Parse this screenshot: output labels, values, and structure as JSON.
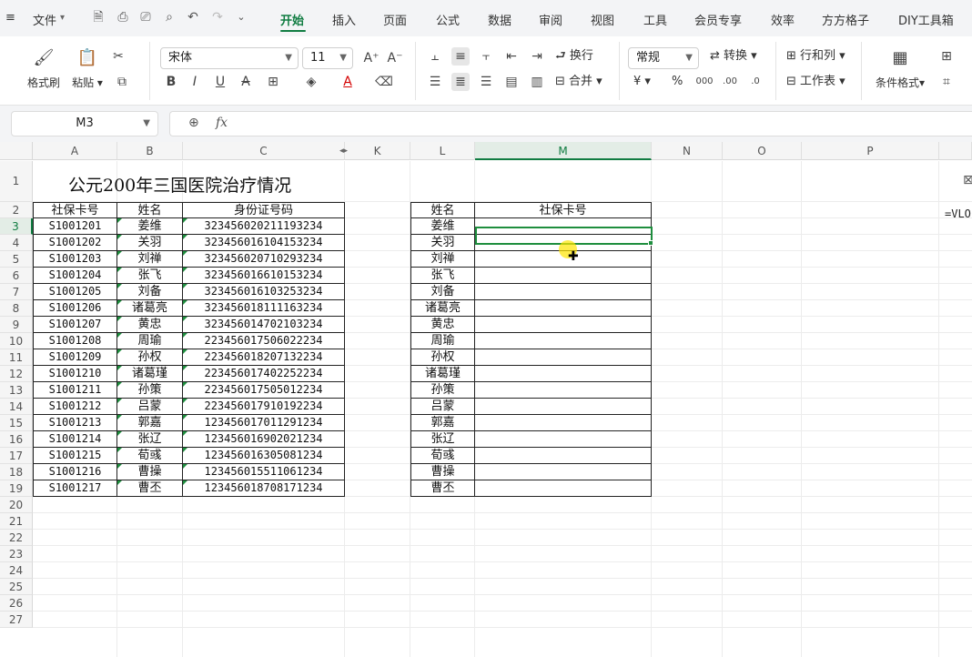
{
  "menubar": {
    "file_label": "文件",
    "tabs": [
      "开始",
      "插入",
      "页面",
      "公式",
      "数据",
      "审阅",
      "视图",
      "工具",
      "会员专享",
      "效率",
      "方方格子",
      "DIY工具箱"
    ],
    "active_tab": "开始"
  },
  "ribbon": {
    "format_painter": "格式刷",
    "paste": "粘贴",
    "font_name": "宋体",
    "font_size": "11",
    "wrap": "换行",
    "merge": "合并",
    "number_format": "常规",
    "convert": "转换",
    "rows_cols": "行和列",
    "worksheet": "工作表",
    "cond_format": "条件格式",
    "bold": "B",
    "italic": "I",
    "underline": "U",
    "strike": "A",
    "currency": "¥",
    "percent": "%"
  },
  "formula_bar": {
    "name_box": "M3",
    "fx": "fx",
    "formula": ""
  },
  "sheet": {
    "columns": [
      "A",
      "B",
      "C",
      "K",
      "L",
      "M",
      "N",
      "O",
      "P"
    ],
    "rows": [
      "1",
      "2",
      "3",
      "4",
      "5",
      "6",
      "7",
      "8",
      "9",
      "10",
      "11",
      "12",
      "13",
      "14",
      "15",
      "16",
      "17",
      "18",
      "19",
      "20",
      "21",
      "22",
      "23",
      "24",
      "25",
      "26",
      "27"
    ],
    "title": "公元200年三国医院治疗情况",
    "left_headers": [
      "社保卡号",
      "姓名",
      "身份证号码"
    ],
    "right_headers": [
      "姓名",
      "社保卡号"
    ],
    "records": [
      [
        "S1001201",
        "姜维",
        "323456020211193234"
      ],
      [
        "S1001202",
        "关羽",
        "323456016104153234"
      ],
      [
        "S1001203",
        "刘禅",
        "323456020710293234"
      ],
      [
        "S1001204",
        "张飞",
        "323456016610153234"
      ],
      [
        "S1001205",
        "刘备",
        "323456016103253234"
      ],
      [
        "S1001206",
        "诸葛亮",
        "323456018111163234"
      ],
      [
        "S1001207",
        "黄忠",
        "323456014702103234"
      ],
      [
        "S1001208",
        "周瑜",
        "223456017506022234"
      ],
      [
        "S1001209",
        "孙权",
        "223456018207132234"
      ],
      [
        "S1001210",
        "诸葛瑾",
        "223456017402252234"
      ],
      [
        "S1001211",
        "孙策",
        "223456017505012234"
      ],
      [
        "S1001212",
        "吕蒙",
        "223456017910192234"
      ],
      [
        "S1001213",
        "郭嘉",
        "123456017011291234"
      ],
      [
        "S1001214",
        "张辽",
        "123456016902021234"
      ],
      [
        "S1001215",
        "荀彧",
        "123456016305081234"
      ],
      [
        "S1001216",
        "曹操",
        "123456015511061234"
      ],
      [
        "S1001217",
        "曹丕",
        "123456018708171234"
      ]
    ],
    "lookup_names": [
      "姜维",
      "关羽",
      "刘禅",
      "张飞",
      "刘备",
      "诸葛亮",
      "黄忠",
      "周瑜",
      "孙权",
      "诸葛瑾",
      "孙策",
      "吕蒙",
      "郭嘉",
      "张辽",
      "荀彧",
      "曹操",
      "曹丕"
    ],
    "formula_hint": "=VLO"
  }
}
